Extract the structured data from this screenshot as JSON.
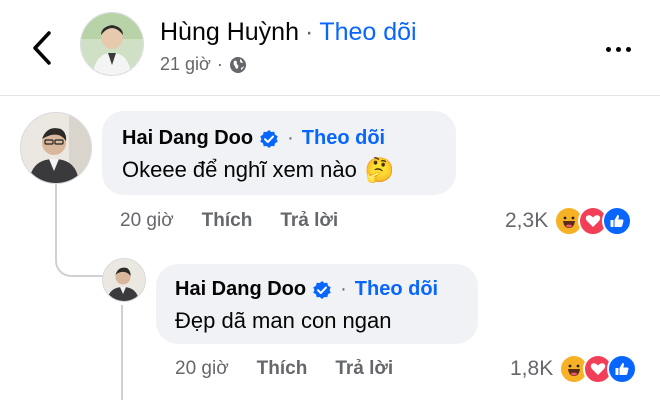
{
  "header": {
    "name": "Hùng Huỳnh",
    "separator": "·",
    "follow_label": "Theo dõi",
    "time": "21 giờ",
    "meta_separator": "·"
  },
  "comments": [
    {
      "author": "Hai Dang Doo",
      "separator": "·",
      "follow_label": "Theo dõi",
      "text": "Okeee để nghĩ xem nào",
      "emoji": "🤔",
      "time": "20 giờ",
      "like_label": "Thích",
      "reply_label": "Trả lời",
      "reaction_count": "2,3K"
    },
    {
      "author": "Hai Dang Doo",
      "separator": "·",
      "follow_label": "Theo dõi",
      "text": "Đẹp dã man con ngan",
      "time": "20 giờ",
      "like_label": "Thích",
      "reply_label": "Trả lời",
      "reaction_count": "1,8K"
    }
  ],
  "icons": {
    "back": "chevron-left-icon",
    "globe": "globe-icon",
    "more": "more-icon",
    "verified": "verified-badge-icon",
    "reactions": [
      "haha-reaction-icon",
      "love-reaction-icon",
      "like-reaction-icon"
    ]
  },
  "colors": {
    "accent": "#0866ff",
    "secondary_text": "#65676b",
    "bubble": "#f0f2f5",
    "love": "#f33e58",
    "haha": "#f7b125"
  }
}
